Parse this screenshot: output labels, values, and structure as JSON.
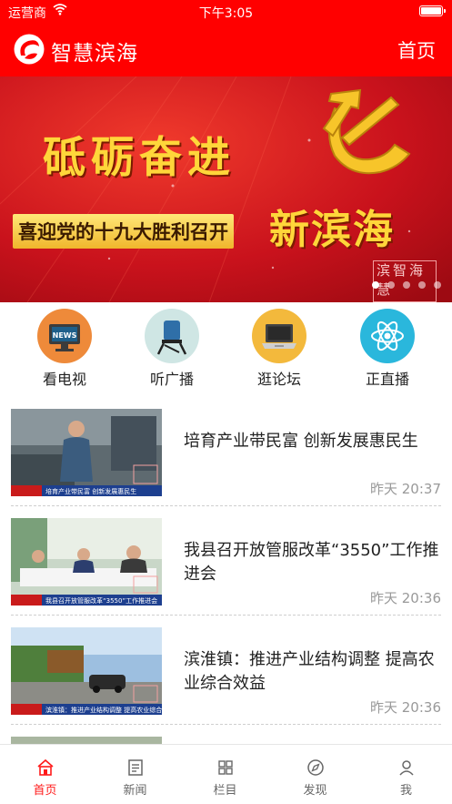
{
  "status_bar": {
    "carrier": "运营商",
    "time": "下午3:05"
  },
  "nav": {
    "title": "智慧滨海",
    "home_link": "首页",
    "logo_icon": "app-logo-icon"
  },
  "banner": {
    "slogan_main": "砥砺奋进",
    "slogan_sub": "喜迎党的十九大胜利召开",
    "slogan_city": "新滨海",
    "stamp": "滨智海慧",
    "slide_count": 5,
    "active_slide": 1
  },
  "quick_links": [
    {
      "label": "看电视",
      "icon": "tv-news-icon",
      "color": "#ee8a3a"
    },
    {
      "label": "听广播",
      "icon": "radio-chair-icon",
      "color": "#2f8ea8"
    },
    {
      "label": "逛论坛",
      "icon": "laptop-icon",
      "color": "#f3b93c"
    },
    {
      "label": "正直播",
      "icon": "atom-icon",
      "color": "#2ab7dc"
    }
  ],
  "news": [
    {
      "headline": "培育产业带民富 创新发展惠民生",
      "time": "昨天 20:37",
      "thumb_caption": "培育产业带民富 创新发展惠民生"
    },
    {
      "headline": "我县召开放管服改革“3550”工作推进会",
      "time": "昨天 20:36",
      "thumb_caption": "我县召开放管服改革“3550”工作推进会"
    },
    {
      "headline": "滨淮镇：推进产业结构调整 提高农业综合效益",
      "time": "昨天 20:36",
      "thumb_caption": "滨淮镇：推进产业结构调整 提高农业综合效益"
    }
  ],
  "tabs": [
    {
      "label": "首页",
      "icon": "home-icon",
      "active": true
    },
    {
      "label": "新闻",
      "icon": "news-icon",
      "active": false
    },
    {
      "label": "栏目",
      "icon": "grid-icon",
      "active": false
    },
    {
      "label": "发现",
      "icon": "compass-icon",
      "active": false
    },
    {
      "label": "我",
      "icon": "user-icon",
      "active": false
    }
  ],
  "colors": {
    "brand_red": "#ff0000",
    "active_tab": "#ff1a1a",
    "banner_gold": "#ffd63a"
  }
}
